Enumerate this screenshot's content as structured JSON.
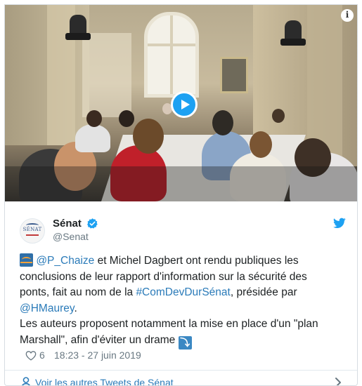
{
  "media": {
    "type": "video",
    "play_icon": "play-icon",
    "info_icon": "info-icon",
    "info_glyph": "i"
  },
  "author": {
    "display_name": "Sénat",
    "handle": "@Senat",
    "avatar_text": "SÉNAT",
    "verified_icon": "verified-badge-icon"
  },
  "tweet": {
    "emoji_start": "bridge-at-night-emoji",
    "mention_1": "@P_Chaize",
    "text_1": " et Michel Dagbert ont rendu publiques les",
    "text_2": "conclusions de leur rapport d'information sur la sécurité des",
    "text_3a": "ponts, fait au nom de la ",
    "hashtag": "#ComDevDurSénat",
    "text_3b": ", présidée par",
    "mention_2": "@HMaurey",
    "text_4b": ".",
    "text_5": "Les auteurs proposent notamment la mise en place d'un \"plan",
    "text_6": "Marshall\", afin d'éviter un drame ",
    "emoji_end": "arrow-down-emoji",
    "emoji_end_glyph": "⤵"
  },
  "meta": {
    "like_count": "6",
    "timestamp": "18:23 - 27 juin 2019"
  },
  "footer": {
    "link_label": "Voir les autres Tweets de Sénat"
  },
  "colors": {
    "link": "#2b7bb9",
    "twitter_blue": "#1da1f2",
    "text": "#1c2022",
    "muted": "#697882",
    "border": "#e1e8ed"
  }
}
